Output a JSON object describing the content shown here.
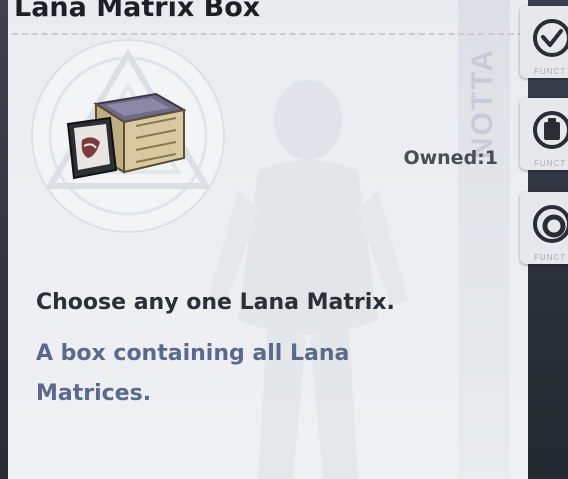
{
  "item": {
    "name": "Lana Matrix Box",
    "owned_label": "Owned:",
    "owned_count": "1",
    "owned_text": "Owned:1",
    "description_main": "Choose any one Lana Matrix.",
    "description_sub": "A box containing all Lana Matrices.",
    "icon": "matrix-box-icon"
  },
  "background": {
    "strip_text": "NOTTA"
  },
  "side_tabs": [
    {
      "icon": "check-circle-icon",
      "label": "FUNCT"
    },
    {
      "icon": "clipboard-icon",
      "label": "FUNCT"
    },
    {
      "icon": "ring-icon",
      "label": "FUNCT"
    }
  ],
  "colors": {
    "panel_bg": "#edeef1",
    "title": "#1d1f24",
    "description_main": "#2c2f35",
    "description_sub": "#5b6a8c",
    "owned": "#4a4d54",
    "rail_bg": "#2b303b"
  }
}
